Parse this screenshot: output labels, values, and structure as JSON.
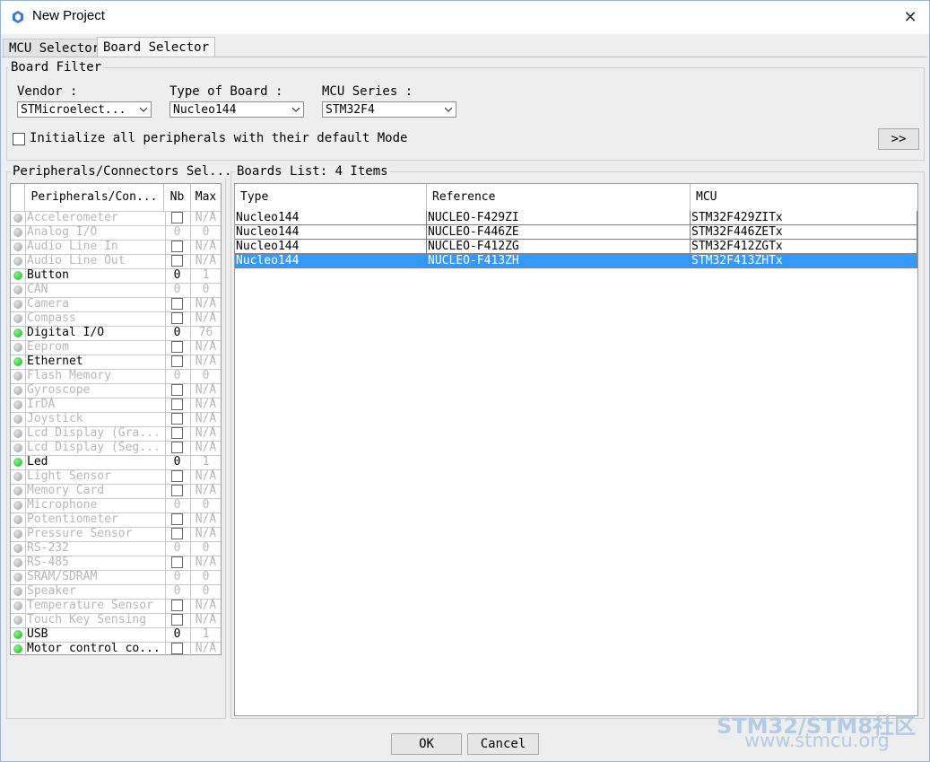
{
  "window": {
    "title": "New Project",
    "close_glyph": "✕"
  },
  "tabs": [
    {
      "label": "MCU Selector",
      "active": false
    },
    {
      "label": "Board Selector",
      "active": true
    }
  ],
  "board_filter": {
    "title": "Board Filter",
    "vendor": {
      "label": "Vendor :",
      "value": "STMicroelect..."
    },
    "type_of_board": {
      "label": "Type of Board :",
      "value": "Nucleo144"
    },
    "mcu_series": {
      "label": "MCU Series :",
      "value": "STM32F4"
    },
    "init_checkbox": {
      "label": "Initialize all peripherals with their default Mode",
      "checked": false
    },
    "expand_button": ">>"
  },
  "peripherals_panel": {
    "title": "Peripherals/Connectors Sel...",
    "headers": {
      "name": "Peripherals/Con...",
      "nb": "Nb",
      "max": "Max"
    },
    "rows": [
      {
        "name": "Accelerometer",
        "nb": "",
        "nb_box": true,
        "max": "N/A",
        "enabled": false
      },
      {
        "name": "Analog I/O",
        "nb": "0",
        "nb_box": false,
        "max": "0",
        "enabled": false
      },
      {
        "name": "Audio Line In",
        "nb": "",
        "nb_box": true,
        "max": "N/A",
        "enabled": false
      },
      {
        "name": "Audio Line Out",
        "nb": "",
        "nb_box": true,
        "max": "N/A",
        "enabled": false
      },
      {
        "name": "Button",
        "nb": "0",
        "nb_box": false,
        "max": "1",
        "enabled": true
      },
      {
        "name": "CAN",
        "nb": "0",
        "nb_box": false,
        "max": "0",
        "enabled": false
      },
      {
        "name": "Camera",
        "nb": "",
        "nb_box": true,
        "max": "N/A",
        "enabled": false
      },
      {
        "name": "Compass",
        "nb": "",
        "nb_box": true,
        "max": "N/A",
        "enabled": false
      },
      {
        "name": "Digital I/O",
        "nb": "0",
        "nb_box": false,
        "max": "76",
        "enabled": true
      },
      {
        "name": "Eeprom",
        "nb": "",
        "nb_box": true,
        "max": "N/A",
        "enabled": false
      },
      {
        "name": "Ethernet",
        "nb": "",
        "nb_box": true,
        "max": "N/A",
        "enabled": true
      },
      {
        "name": "Flash Memory",
        "nb": "0",
        "nb_box": false,
        "max": "0",
        "enabled": false
      },
      {
        "name": "Gyroscope",
        "nb": "",
        "nb_box": true,
        "max": "N/A",
        "enabled": false
      },
      {
        "name": "IrDA",
        "nb": "",
        "nb_box": true,
        "max": "N/A",
        "enabled": false
      },
      {
        "name": "Joystick",
        "nb": "",
        "nb_box": true,
        "max": "N/A",
        "enabled": false
      },
      {
        "name": "Lcd Display (Gra...",
        "nb": "",
        "nb_box": true,
        "max": "N/A",
        "enabled": false
      },
      {
        "name": "Lcd Display (Seg...",
        "nb": "",
        "nb_box": true,
        "max": "N/A",
        "enabled": false
      },
      {
        "name": "Led",
        "nb": "0",
        "nb_box": false,
        "max": "1",
        "enabled": true
      },
      {
        "name": "Light Sensor",
        "nb": "",
        "nb_box": true,
        "max": "N/A",
        "enabled": false
      },
      {
        "name": "Memory Card",
        "nb": "",
        "nb_box": true,
        "max": "N/A",
        "enabled": false
      },
      {
        "name": "Microphone",
        "nb": "0",
        "nb_box": false,
        "max": "0",
        "enabled": false
      },
      {
        "name": "Potentiometer",
        "nb": "",
        "nb_box": true,
        "max": "N/A",
        "enabled": false
      },
      {
        "name": "Pressure Sensor",
        "nb": "",
        "nb_box": true,
        "max": "N/A",
        "enabled": false
      },
      {
        "name": "RS-232",
        "nb": "0",
        "nb_box": false,
        "max": "0",
        "enabled": false
      },
      {
        "name": "RS-485",
        "nb": "",
        "nb_box": true,
        "max": "N/A",
        "enabled": false
      },
      {
        "name": "SRAM/SDRAM",
        "nb": "0",
        "nb_box": false,
        "max": "0",
        "enabled": false
      },
      {
        "name": "Speaker",
        "nb": "0",
        "nb_box": false,
        "max": "0",
        "enabled": false
      },
      {
        "name": "Temperature Sensor",
        "nb": "",
        "nb_box": true,
        "max": "N/A",
        "enabled": false
      },
      {
        "name": "Touch Key Sensing",
        "nb": "",
        "nb_box": true,
        "max": "N/A",
        "enabled": false
      },
      {
        "name": "USB",
        "nb": "0",
        "nb_box": false,
        "max": "1",
        "enabled": true
      },
      {
        "name": "Motor control co...",
        "nb": "",
        "nb_box": true,
        "max": "N/A",
        "enabled": true
      }
    ]
  },
  "boards_panel": {
    "title": "Boards List: 4 Items",
    "headers": {
      "type": "Type",
      "reference": "Reference",
      "mcu": "MCU"
    },
    "rows": [
      {
        "type": "Nucleo144",
        "reference": "NUCLEO-F429ZI",
        "mcu": "STM32F429ZITx",
        "selected": false
      },
      {
        "type": "Nucleo144",
        "reference": "NUCLEO-F446ZE",
        "mcu": "STM32F446ZETx",
        "selected": false
      },
      {
        "type": "Nucleo144",
        "reference": "NUCLEO-F412ZG",
        "mcu": "STM32F412ZGTx",
        "selected": false
      },
      {
        "type": "Nucleo144",
        "reference": "NUCLEO-F413ZH",
        "mcu": "STM32F413ZHTx",
        "selected": true
      }
    ]
  },
  "footer": {
    "ok_label": "OK",
    "cancel_label": "Cancel"
  },
  "watermark": {
    "line1": "STM32/STM8社区",
    "line2": "www.stmcu.org"
  },
  "colors": {
    "selection": "#3399ff",
    "status_on": "#22c022",
    "status_off": "#a8a8a8",
    "watermark": "#b3cbe3"
  }
}
